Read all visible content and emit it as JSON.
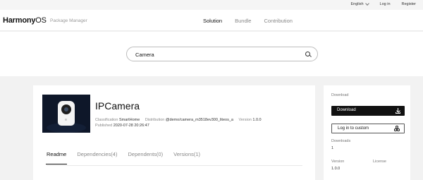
{
  "topbar": {
    "language": "English",
    "login": "Log in",
    "register": "Register"
  },
  "header": {
    "brand_harmony": "Harmony",
    "brand_os": "OS",
    "subbrand": "Package Manager",
    "nav": [
      {
        "label": "Solution",
        "active": true
      },
      {
        "label": "Bundle",
        "active": false
      },
      {
        "label": "Contribution",
        "active": false
      }
    ]
  },
  "search": {
    "value": "Camera",
    "icon": "search-icon"
  },
  "package": {
    "title": "IPCamera",
    "classification_label": "Classification",
    "classification": "SmartHome",
    "distribution_label": "Distribution",
    "distribution": "@demo/camera_m3518ev300_liteos_a",
    "version_label": "Version",
    "version": "1.0.0",
    "published_label": "Published",
    "published": "2020-07-28 20:26:47"
  },
  "tabs": [
    {
      "label": "Readme",
      "active": true
    },
    {
      "label": "Dependencies(4)",
      "active": false
    },
    {
      "label": "Dependents(0)",
      "active": false
    },
    {
      "label": "Versions(1)",
      "active": false
    }
  ],
  "sidebar": {
    "download_label": "Download",
    "download_button": "Download",
    "download_icon": "download-icon",
    "login_button": "Log in to custom",
    "login_icon": "nodes-icon",
    "downloads_label": "Downloads",
    "downloads_value": "1",
    "version_label": "Version",
    "version_value": "1.0.0",
    "license_label": "License"
  }
}
